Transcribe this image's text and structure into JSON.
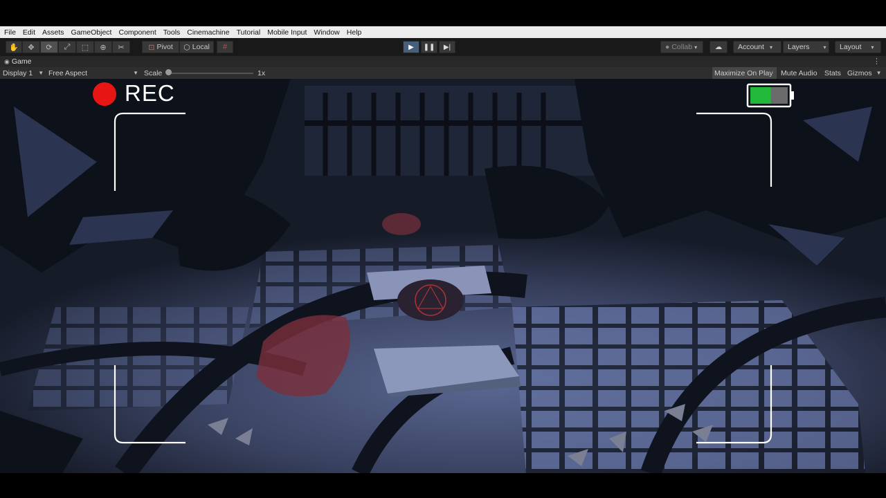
{
  "menu": [
    "File",
    "Edit",
    "Assets",
    "GameObject",
    "Component",
    "Tools",
    "Cinemachine",
    "Tutorial",
    "Mobile Input",
    "Window",
    "Help"
  ],
  "toolbar": {
    "tools": [
      "hand-icon",
      "move-icon",
      "rotate-icon",
      "scale-icon",
      "rect-icon",
      "transform-icon",
      "custom-tool-icon"
    ],
    "pivot": "Pivot",
    "local": "Local",
    "collab": "Collab",
    "account": "Account",
    "layers": "Layers",
    "layout": "Layout"
  },
  "tab": {
    "label": "Game"
  },
  "game_toolbar": {
    "display": "Display 1",
    "aspect": "Free Aspect",
    "scale_label": "Scale",
    "scale_value": "1x",
    "maximize": "Maximize On Play",
    "mute": "Mute Audio",
    "stats": "Stats",
    "gizmos": "Gizmos"
  },
  "hud": {
    "rec_label": "REC",
    "battery_level": 0.55,
    "colors": {
      "rec": "#e81515",
      "battery": "#22b83a",
      "frame": "#ffffff"
    }
  }
}
